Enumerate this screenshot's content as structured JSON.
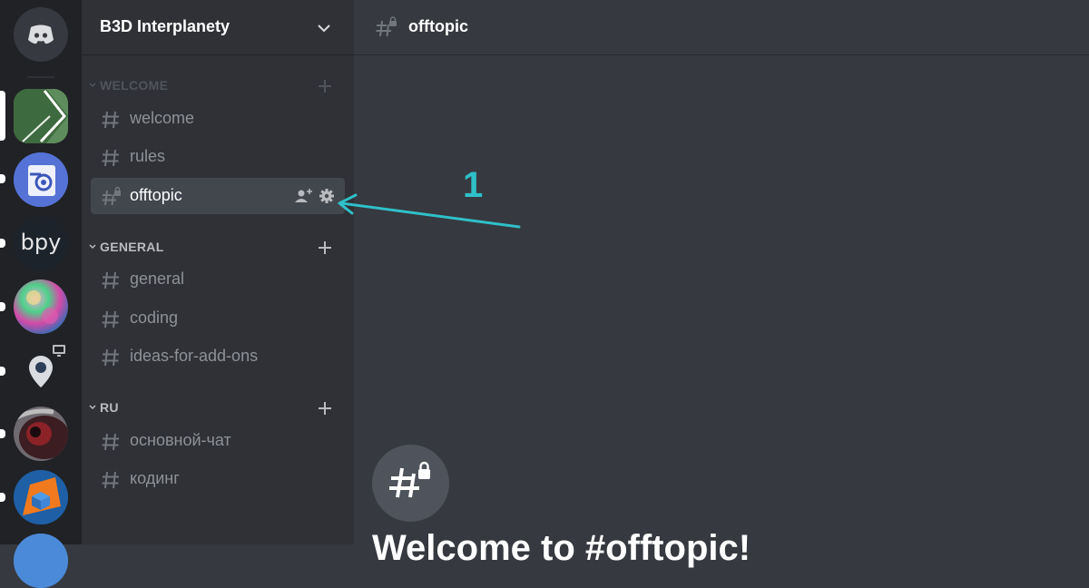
{
  "server_rail": {
    "home_icon": "discord-logo-icon",
    "servers": [
      {
        "name": "green-arrow-server",
        "icon": "server-arrow-icon",
        "selected": true
      },
      {
        "name": "blender-server",
        "icon": "blender-logo-icon",
        "unread": true
      },
      {
        "name": "bpy-server",
        "label": "bpy",
        "unread": true
      },
      {
        "name": "colorful-sphere-server",
        "icon": "server-sphere-icon",
        "unread": true
      },
      {
        "name": "pin-server",
        "icon": "server-pin-icon",
        "unread": true
      },
      {
        "name": "eye-server",
        "icon": "server-eye-icon",
        "unread": true
      },
      {
        "name": "orange-cube-server",
        "icon": "server-cube-icon",
        "unread": true
      },
      {
        "name": "blue-server",
        "icon": "server-blue-icon"
      }
    ]
  },
  "guild": {
    "name": "B3D Interplanety",
    "menu_icon": "chevron-down-icon"
  },
  "categories": [
    {
      "name": "WELCOME",
      "channels": [
        {
          "name": "welcome",
          "icon": "hash-icon"
        },
        {
          "name": "rules",
          "icon": "hash-icon"
        },
        {
          "name": "offtopic",
          "icon": "hash-lock-icon",
          "selected": true,
          "actions": [
            "invite-icon",
            "gear-icon"
          ]
        }
      ]
    },
    {
      "name": "GENERAL",
      "channels": [
        {
          "name": "general",
          "icon": "hash-icon"
        },
        {
          "name": "coding",
          "icon": "hash-icon"
        },
        {
          "name": "ideas-for-add-ons",
          "icon": "hash-icon"
        }
      ]
    },
    {
      "name": "RU",
      "channels": [
        {
          "name": "основной-чат",
          "icon": "hash-icon"
        },
        {
          "name": "кодинг",
          "icon": "hash-icon"
        }
      ]
    }
  ],
  "main": {
    "channel_title": "offtopic",
    "welcome_text": "Welcome to #offtopic!"
  },
  "annotation": {
    "number": "1",
    "color": "#2fc0c9"
  },
  "colors": {
    "rail_bg": "#202225",
    "sidebar_bg": "#2f3136",
    "main_bg": "#36393f",
    "selected_bg": "#42464d",
    "muted_text": "#8e9297",
    "category_text_collapsed": "#72767d",
    "category_text": "#b9bbbe"
  }
}
